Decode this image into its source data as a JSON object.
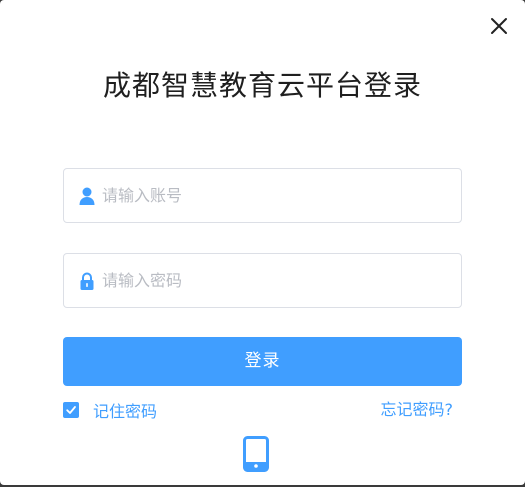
{
  "dialog": {
    "title": "成都智慧教育云平台登录",
    "close_icon": "close-icon"
  },
  "form": {
    "username": {
      "placeholder": "请输入账号",
      "value": "",
      "icon": "user-icon"
    },
    "password": {
      "placeholder": "请输入密码",
      "value": "",
      "icon": "lock-icon"
    },
    "login_label": "登录",
    "remember_label": "记住密码",
    "remember_checked": true,
    "forgot_label": "忘记密码?",
    "alt_login_icon": "mobile-phone-icon"
  },
  "colors": {
    "accent": "#409eff",
    "border": "#dcdfe6",
    "placeholder": "#b9bcc3",
    "title": "#1f1f1f"
  }
}
